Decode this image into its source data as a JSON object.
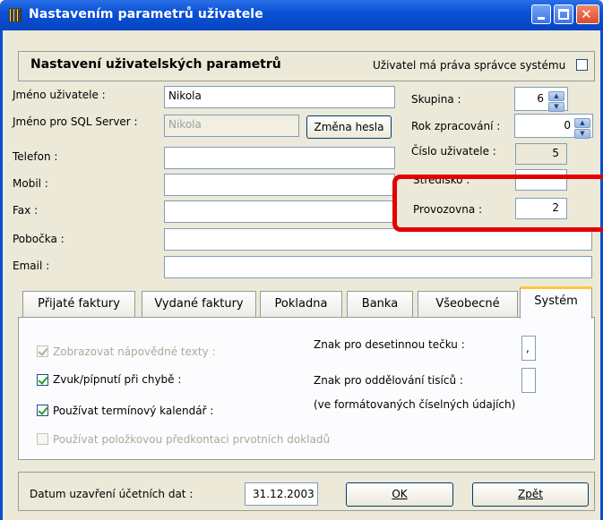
{
  "window": {
    "title": "Nastavením parametrů uživatele"
  },
  "header": {
    "title": "Nastavení uživatelských parametrů",
    "admin_checkbox_label": "Uživatel má práva správce systému",
    "admin_checked": false
  },
  "form": {
    "username_label": "Jméno uživatele :",
    "username_value": "Nikola",
    "sqlname_label": "Jméno pro SQL Server :",
    "sqlname_value": "Nikola",
    "change_password_label": "Změna hesla",
    "phone_label": "Telefon :",
    "mobile_label": "Mobil :",
    "fax_label": "Fax :",
    "branch_label": "Pobočka :",
    "email_label": "Email :",
    "group_label": "Skupina :",
    "group_value": "6",
    "year_label": "Rok zpracování :",
    "year_value": "0",
    "usernum_label": "Číslo uživatele :",
    "usernum_value": "5",
    "center_label": "Středisko :",
    "office_label": "Provozovna :",
    "office_value": "2"
  },
  "tabs": [
    {
      "label": "Přijaté faktury"
    },
    {
      "label": "Vydané faktury"
    },
    {
      "label": "Pokladna"
    },
    {
      "label": "Banka"
    },
    {
      "label": "Všeobecné"
    },
    {
      "label": "Systém",
      "active": true
    }
  ],
  "system_tab": {
    "show_help_label": "Zobrazovat nápovědné texty :",
    "sound_label": "Zvuk/pípnutí při chybě :",
    "calendar_label": "Používat termínový kalendář :",
    "precontation_label": "Používat položkovou předkontaci prvotních dokladů",
    "decimal_label": "Znak pro desetinnou tečku :",
    "decimal_value": ",",
    "thousands_label": "Znak pro oddělování tisíců :",
    "thousands_note": "(ve formátovaných číselných údajích)"
  },
  "footer": {
    "close_date_label": "Datum uzavření účetních dat :",
    "close_date_value": "31.12.2003",
    "ok_label": "OK",
    "back_label": "Zpět"
  },
  "icons": [
    "app-icon",
    "minimize-icon",
    "maximize-icon",
    "close-icon",
    "spin-up-icon",
    "spin-down-icon"
  ],
  "colors": {
    "titlebar": "#0a52d6",
    "window_bg": "#ece9d8",
    "active_tab_accent": "#ffc83a",
    "highlight": "#e30000"
  }
}
